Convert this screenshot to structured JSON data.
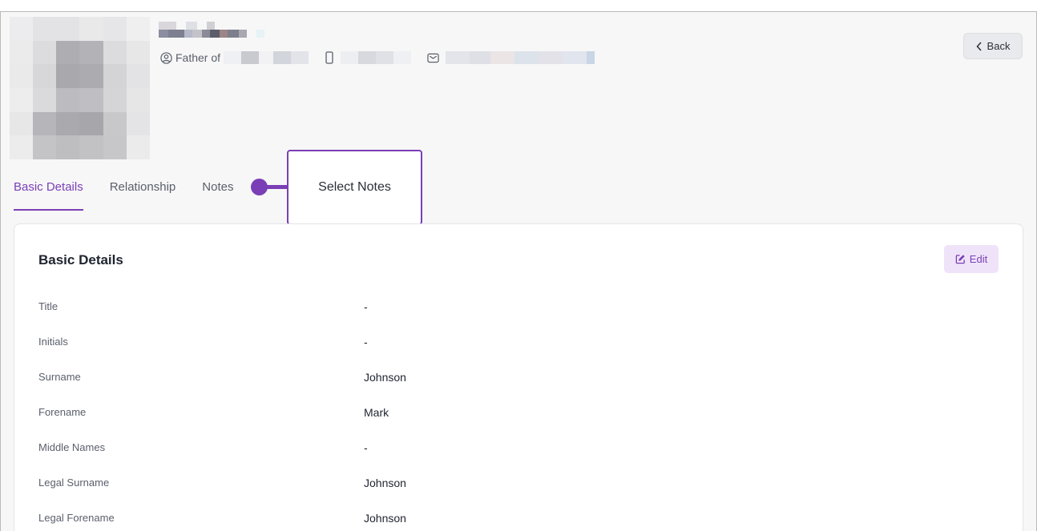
{
  "header": {
    "relation_label": "Father of",
    "back_label": "Back"
  },
  "tabs": [
    {
      "label": "Basic Details",
      "active": true
    },
    {
      "label": "Relationship",
      "active": false
    },
    {
      "label": "Notes",
      "active": false
    }
  ],
  "callout": {
    "text": "Select Notes"
  },
  "card": {
    "title": "Basic Details",
    "edit_label": "Edit"
  },
  "fields": [
    {
      "label": "Title",
      "value": "-"
    },
    {
      "label": "Initials",
      "value": "-"
    },
    {
      "label": "Surname",
      "value": "Johnson"
    },
    {
      "label": "Forename",
      "value": "Mark"
    },
    {
      "label": "Middle Names",
      "value": "-"
    },
    {
      "label": "Legal Surname",
      "value": "Johnson"
    },
    {
      "label": "Legal Forename",
      "value": "Johnson"
    }
  ],
  "colors": {
    "accent": "#7a3fb6",
    "edit_bg": "#efe3f9",
    "page_bg": "#f7f7f7"
  },
  "icons": {
    "person": "person-circle-icon",
    "phone": "phone-icon",
    "email": "envelope-icon",
    "back": "chevron-left-icon",
    "edit": "edit-icon"
  }
}
